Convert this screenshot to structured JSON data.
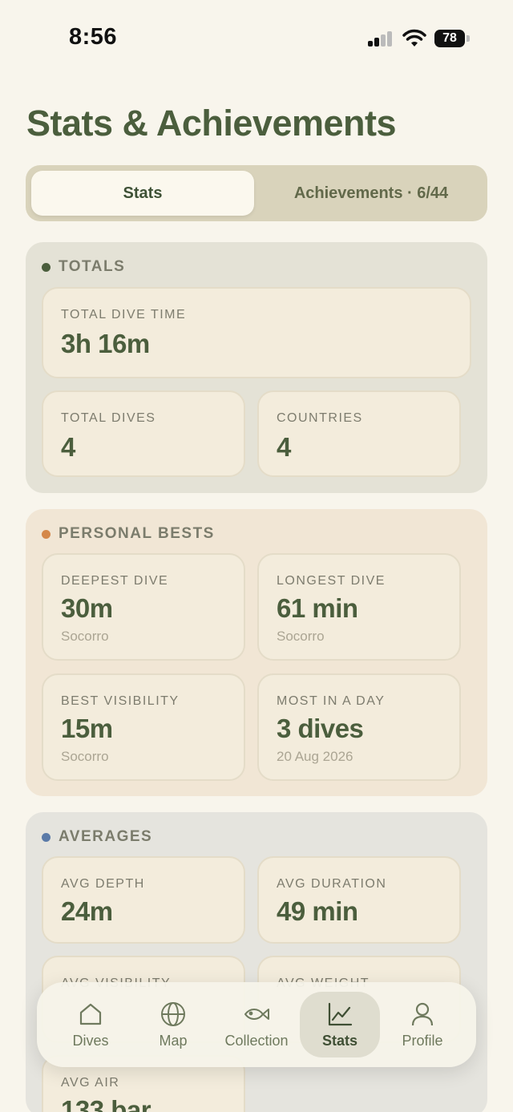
{
  "status": {
    "time": "8:56",
    "battery": "78"
  },
  "page": {
    "title": "Stats & Achievements"
  },
  "tabs": {
    "stats": "Stats",
    "achievements": "Achievements · 6/44"
  },
  "totals": {
    "title": "TOTALS",
    "accent": "#4b5e3d",
    "total_dive_time": {
      "label": "TOTAL DIVE TIME",
      "value": "3h 16m"
    },
    "total_dives": {
      "label": "TOTAL DIVES",
      "value": "4"
    },
    "countries": {
      "label": "COUNTRIES",
      "value": "4"
    }
  },
  "bests": {
    "title": "PERSONAL BESTS",
    "accent": "#d4884a",
    "deepest": {
      "label": "DEEPEST DIVE",
      "value": "30m",
      "sub": "Socorro"
    },
    "longest": {
      "label": "LONGEST DIVE",
      "value": "61 min",
      "sub": "Socorro"
    },
    "visibility": {
      "label": "BEST VISIBILITY",
      "value": "15m",
      "sub": "Socorro"
    },
    "most_day": {
      "label": "MOST IN A DAY",
      "value": "3 dives",
      "sub": "20 Aug 2026"
    }
  },
  "averages": {
    "title": "AVERAGES",
    "accent": "#5a7aa8",
    "depth": {
      "label": "AVG DEPTH",
      "value": "24m"
    },
    "duration": {
      "label": "AVG DURATION",
      "value": "49 min"
    },
    "visibility": {
      "label": "AVG VISIBILITY"
    },
    "weight": {
      "label": "AVG WEIGHT"
    },
    "air": {
      "label": "AVG AIR",
      "value": "133 bar"
    }
  },
  "nav": {
    "items": [
      {
        "label": "Dives",
        "icon": "house-icon"
      },
      {
        "label": "Map",
        "icon": "globe-icon"
      },
      {
        "label": "Collection",
        "icon": "fish-icon"
      },
      {
        "label": "Stats",
        "icon": "chart-icon"
      },
      {
        "label": "Profile",
        "icon": "person-icon"
      }
    ]
  }
}
